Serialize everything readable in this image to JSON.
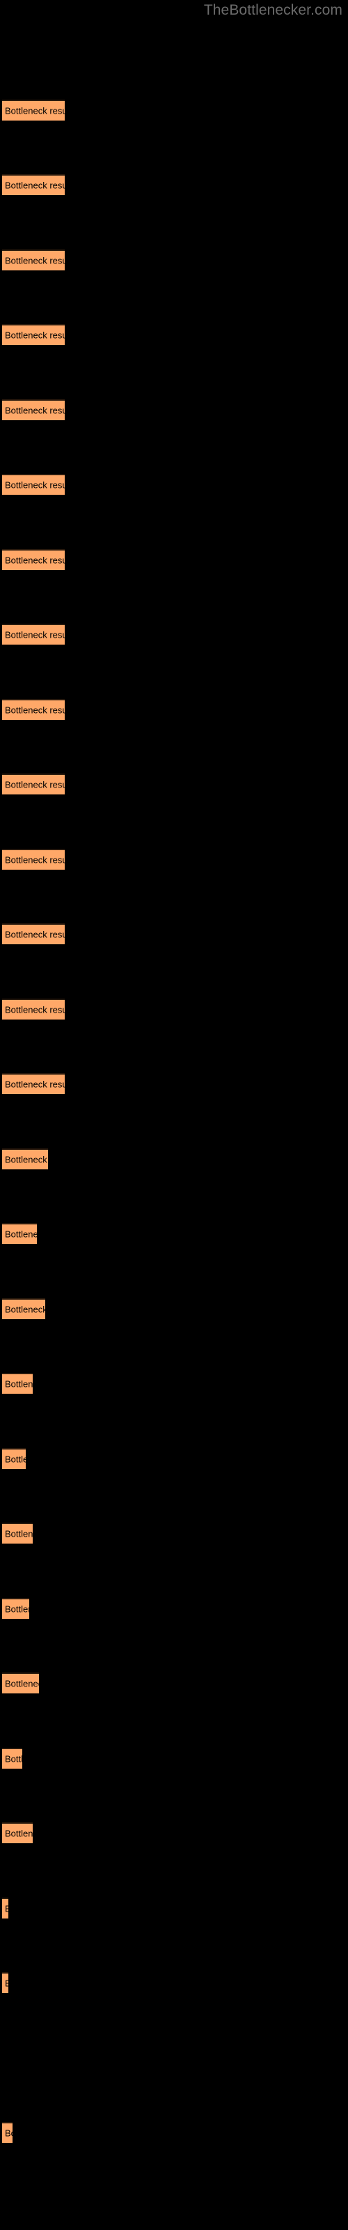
{
  "site": {
    "watermark": "TheBottlenecker.com"
  },
  "chart_data": {
    "type": "bar",
    "orientation": "horizontal",
    "title": "",
    "xlabel": "",
    "ylabel": "",
    "grid": false,
    "legend": false,
    "background_color": "#000000",
    "bar_color": "#ffa868",
    "bar_border_color": "#2a1a0d",
    "label_color": "#000000",
    "watermark_color": "#6b6b6b",
    "bar_label_text": "Bottleneck result",
    "xlim": [
      0,
      500
    ],
    "categories": [
      "bar-1",
      "bar-2",
      "bar-3",
      "bar-4",
      "bar-5",
      "bar-6",
      "bar-7",
      "bar-8",
      "bar-9",
      "bar-10",
      "bar-11",
      "bar-12",
      "bar-13",
      "bar-14",
      "bar-15",
      "bar-16",
      "bar-17",
      "bar-18",
      "bar-19",
      "bar-20",
      "bar-21",
      "bar-22",
      "bar-23",
      "bar-24",
      "bar-25",
      "bar-26",
      "bar-27"
    ],
    "values": [
      90,
      90,
      90,
      90,
      90,
      90,
      90,
      90,
      90,
      90,
      90,
      90,
      90,
      90,
      66,
      50,
      62,
      44,
      34,
      44,
      39,
      53,
      29,
      44,
      9,
      9,
      15
    ],
    "bars": [
      {
        "label": "Bottleneck result",
        "width": 90,
        "top": 57
      },
      {
        "label": "Bottleneck result",
        "width": 90,
        "top": 100
      },
      {
        "label": "Bottleneck result",
        "width": 90,
        "top": 143
      },
      {
        "label": "Bottleneck result",
        "width": 90,
        "top": 186
      },
      {
        "label": "Bottleneck result",
        "width": 90,
        "top": 229
      },
      {
        "label": "Bottleneck result",
        "width": 90,
        "top": 272
      },
      {
        "label": "Bottleneck result",
        "width": 90,
        "top": 315
      },
      {
        "label": "Bottleneck result",
        "width": 90,
        "top": 358
      },
      {
        "label": "Bottleneck result",
        "width": 90,
        "top": 401
      },
      {
        "label": "Bottleneck result",
        "width": 90,
        "top": 444
      },
      {
        "label": "Bottleneck result",
        "width": 90,
        "top": 487
      },
      {
        "label": "Bottleneck result",
        "width": 90,
        "top": 530
      },
      {
        "label": "Bottleneck result",
        "width": 90,
        "top": 573
      },
      {
        "label": "Bottleneck result",
        "width": 90,
        "top": 616
      },
      {
        "label": "Bottleneck result",
        "width": 66,
        "top": 659
      },
      {
        "label": "Bottleneck result",
        "width": 50,
        "top": 702
      },
      {
        "label": "Bottleneck result",
        "width": 62,
        "top": 745
      },
      {
        "label": "Bottleneck result",
        "width": 44,
        "top": 788
      },
      {
        "label": "Bottleneck result",
        "width": 34,
        "top": 831
      },
      {
        "label": "Bottleneck result",
        "width": 44,
        "top": 874
      },
      {
        "label": "Bottleneck result",
        "width": 39,
        "top": 917
      },
      {
        "label": "Bottleneck result",
        "width": 53,
        "top": 960
      },
      {
        "label": "Bottleneck result",
        "width": 29,
        "top": 1003
      },
      {
        "label": "Bottleneck result",
        "width": 44,
        "top": 1046
      },
      {
        "label": "Bottleneck result",
        "width": 9,
        "top": 1089
      },
      {
        "label": "Bottleneck result",
        "width": 9,
        "top": 1132
      },
      {
        "label": "Bottleneck result",
        "width": 15,
        "top": 1218
      }
    ]
  }
}
